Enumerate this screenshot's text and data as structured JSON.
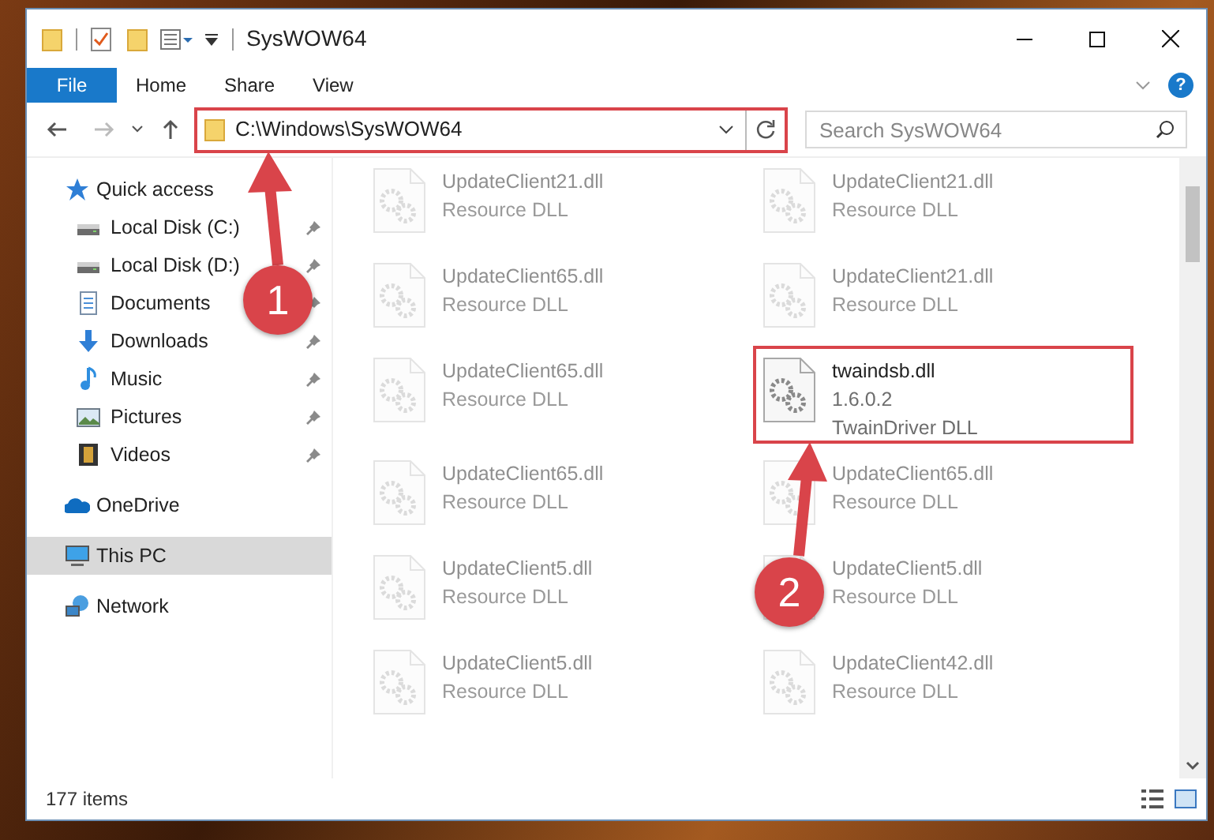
{
  "window": {
    "title": "SysWOW64"
  },
  "ribbon_tabs": [
    {
      "label": "File",
      "kind": "menu"
    },
    {
      "label": "Home",
      "kind": "tab"
    },
    {
      "label": "Share",
      "kind": "tab"
    },
    {
      "label": "View",
      "kind": "tab"
    }
  ],
  "address": {
    "path": "C:\\Windows\\SysWOW64",
    "highlighted": true
  },
  "search": {
    "placeholder": "Search SysWOW64"
  },
  "help_button": {
    "label": "?"
  },
  "sidebar": {
    "items": [
      {
        "label": "Quick access",
        "kind": "star",
        "selected": false,
        "children": [
          {
            "label": "Local Disk (C:)",
            "kind": "drive",
            "pinned": true
          },
          {
            "label": "Local Disk (D:)",
            "kind": "drive",
            "pinned": true
          },
          {
            "label": "Documents",
            "kind": "documents",
            "pinned": true
          },
          {
            "label": "Downloads",
            "kind": "downloads",
            "pinned": true
          },
          {
            "label": "Music",
            "kind": "music",
            "pinned": true
          },
          {
            "label": "Pictures",
            "kind": "pictures",
            "pinned": true
          },
          {
            "label": "Videos",
            "kind": "videos",
            "pinned": true
          }
        ]
      },
      {
        "label": "OneDrive",
        "kind": "cloud",
        "selected": false
      },
      {
        "label": "This PC",
        "kind": "computer",
        "selected": true
      },
      {
        "label": "Network",
        "kind": "network",
        "selected": false
      }
    ]
  },
  "files": [
    {
      "name": "UpdateClient21.dll",
      "lines": [
        "Resource DLL"
      ],
      "dimmed": true,
      "highlighted": false
    },
    {
      "name": "UpdateClient21.dll",
      "lines": [
        "Resource DLL"
      ],
      "dimmed": true,
      "highlighted": false
    },
    {
      "name": "UpdateClient65.dll",
      "lines": [
        "Resource DLL"
      ],
      "dimmed": true,
      "highlighted": false
    },
    {
      "name": "UpdateClient21.dll",
      "lines": [
        "Resource DLL"
      ],
      "dimmed": true,
      "highlighted": false
    },
    {
      "name": "UpdateClient65.dll",
      "lines": [
        "Resource DLL"
      ],
      "dimmed": true,
      "highlighted": false
    },
    {
      "name": "twaindsb.dll",
      "lines": [
        "1.6.0.2",
        "TwainDriver DLL"
      ],
      "dimmed": false,
      "highlighted": true
    },
    {
      "name": "UpdateClient65.dll",
      "lines": [
        "Resource DLL"
      ],
      "dimmed": true,
      "highlighted": false
    },
    {
      "name": "UpdateClient65.dll",
      "lines": [
        "Resource DLL"
      ],
      "dimmed": true,
      "highlighted": false
    },
    {
      "name": "UpdateClient5.dll",
      "lines": [
        "Resource DLL"
      ],
      "dimmed": true,
      "highlighted": false
    },
    {
      "name": "UpdateClient5.dll",
      "lines": [
        "Resource DLL"
      ],
      "dimmed": true,
      "highlighted": false
    },
    {
      "name": "UpdateClient5.dll",
      "lines": [
        "Resource DLL"
      ],
      "dimmed": true,
      "highlighted": false
    },
    {
      "name": "UpdateClient42.dll",
      "lines": [
        "Resource DLL"
      ],
      "dimmed": true,
      "highlighted": false
    }
  ],
  "status_bar": {
    "item_count": "177 items"
  },
  "annotations": [
    {
      "label": "1"
    },
    {
      "label": "2"
    }
  ]
}
